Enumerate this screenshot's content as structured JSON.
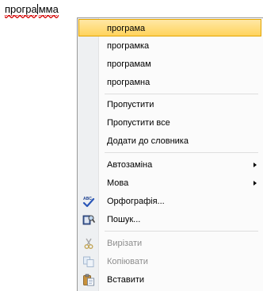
{
  "document": {
    "word_before_caret": "програ",
    "word_after_caret": "мма"
  },
  "context_menu": {
    "suggestions": [
      "програма",
      "програмка",
      "програмам",
      "програмна"
    ],
    "ignore": "Пропустити",
    "ignore_all": "Пропустити все",
    "add_to_dictionary": "Додати до словника",
    "autocorrect": "Автозаміна",
    "language": "Мова",
    "spelling": "Орфографія...",
    "search": "Пошук...",
    "cut": "Вирізати",
    "copy": "Копіювати",
    "paste": "Вставити"
  },
  "colors": {
    "highlight": "#ffd35c",
    "spell_underline": "#d40000"
  }
}
